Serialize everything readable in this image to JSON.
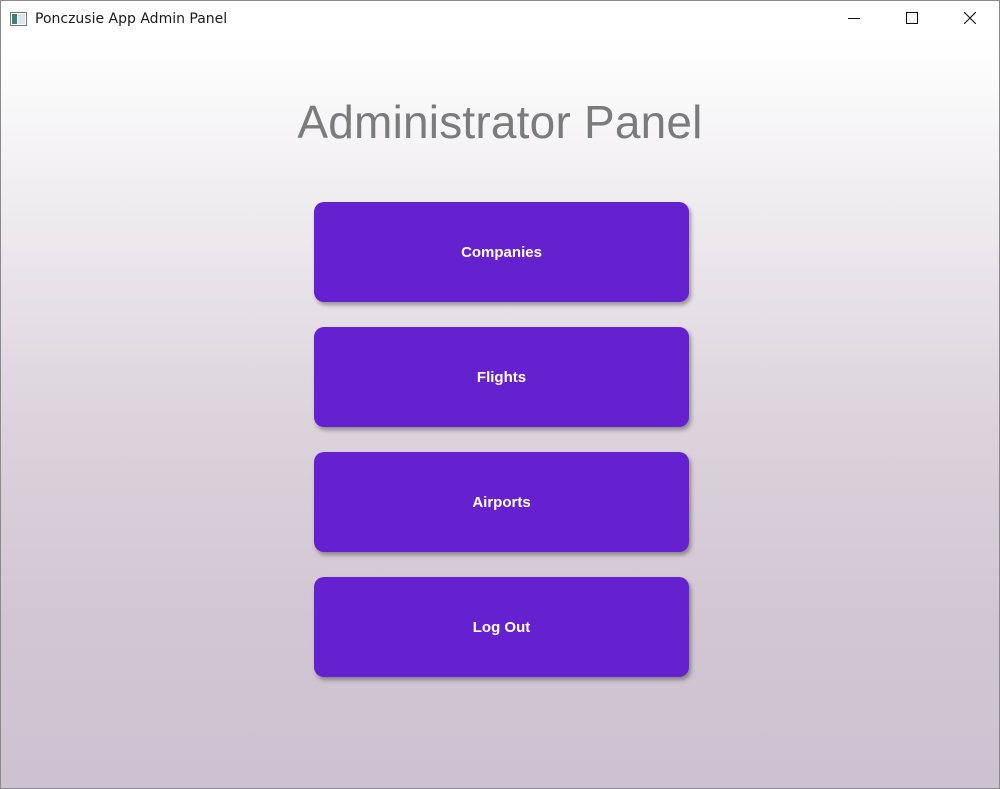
{
  "window": {
    "title": "Ponczusie App Admin Panel",
    "icon": "app-window-icon",
    "controls": {
      "minimize_icon": "minimize-icon",
      "maximize_icon": "maximize-icon",
      "close_icon": "close-icon"
    }
  },
  "main": {
    "heading": "Administrator Panel",
    "buttons": [
      {
        "label": "Companies"
      },
      {
        "label": "Flights"
      },
      {
        "label": "Airports"
      },
      {
        "label": "Log Out"
      }
    ]
  },
  "colors": {
    "button_bg": "#6521cf",
    "button_text": "#ffffff",
    "heading": "#7b7b7b"
  }
}
